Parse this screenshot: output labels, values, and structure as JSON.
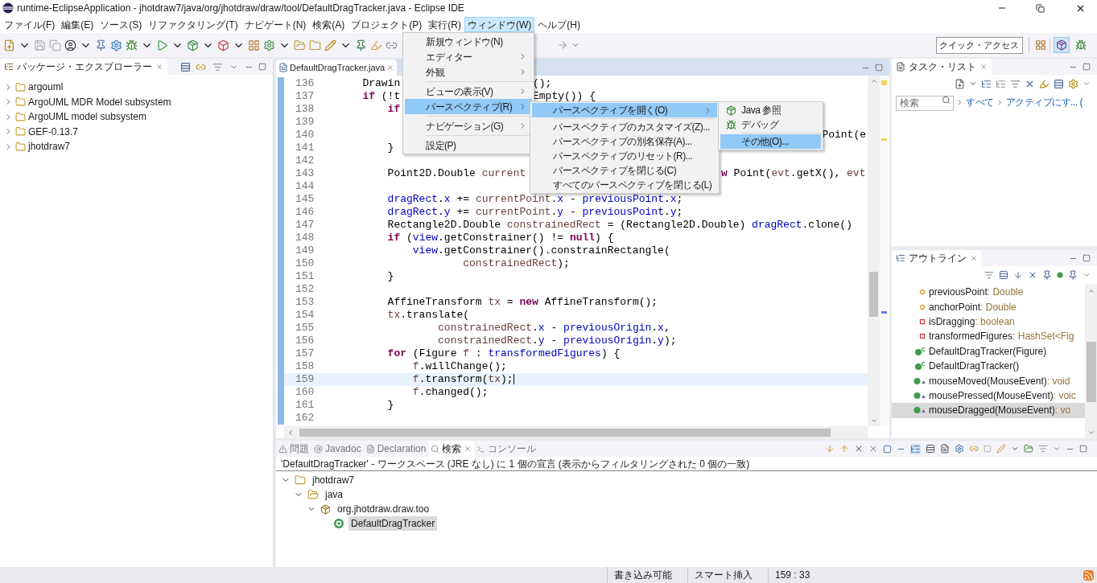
{
  "window": {
    "title": "runtime-EclipseApplication - jhotdraw7/java/org/jhotdraw/draw/tool/DefaultDragTracker.java - Eclipse IDE"
  },
  "menu_bar": [
    {
      "label": "ファイル(F)",
      "selected": false
    },
    {
      "label": "編集(E)",
      "selected": false
    },
    {
      "label": "ソース(S)",
      "selected": false
    },
    {
      "label": "リファクタリング(T)",
      "selected": false
    },
    {
      "label": "ナビゲート(N)",
      "selected": false
    },
    {
      "label": "検索(A)",
      "selected": false
    },
    {
      "label": "プロジェクト(P)",
      "selected": false
    },
    {
      "label": "実行(R)",
      "selected": false
    },
    {
      "label": "ウィンドウ(W)",
      "selected": true
    },
    {
      "label": "ヘルプ(H)",
      "selected": false
    }
  ],
  "toolbar": {
    "quick_access": {
      "placeholder": "クイック・アクセス"
    },
    "perspectives": [
      {
        "kind": "java",
        "selected": true
      },
      {
        "kind": "debug",
        "selected": false
      }
    ]
  },
  "package_explorer": {
    "tab": "パッケージ・エクスプローラー",
    "items": [
      {
        "label": "argouml",
        "expanded": false
      },
      {
        "label": "ArgoUML MDR Model subsystem",
        "expanded": false
      },
      {
        "label": "ArgoUML model subsystem",
        "expanded": false
      },
      {
        "label": "GEF-0.13.7",
        "expanded": false
      },
      {
        "label": "jhotdraw7",
        "expanded": false
      }
    ]
  },
  "editor": {
    "tab": "DefaultDragTracker.java",
    "lines": [
      {
        "number": "136",
        "current": false,
        "segments": [
          {
            "kind": "plain",
            "t": "        Drawin"
          }
        ],
        "right": {
          "kind": "after_window_menu",
          "segments": [
            {
              "kind": "plain",
              "t": "();"
            }
          ]
        }
      },
      {
        "number": "137",
        "current": false,
        "segments": [
          {
            "kind": "keyword",
            "t": "        if"
          },
          {
            "kind": "plain",
            "t": " (!t"
          }
        ],
        "right": {
          "kind": "after_window_menu",
          "segments": [
            {
              "kind": "plain",
              "t": "Empty()) {"
            }
          ]
        }
      },
      {
        "number": "138",
        "current": false,
        "segments": [
          {
            "kind": "keyword",
            "t": "            if"
          }
        ]
      },
      {
        "number": "139",
        "current": false
      },
      {
        "number": "140",
        "current": false,
        "right": {
          "kind": "after_other_submenu",
          "segments": [
            {
              "kind": "plain",
              "t": "Point(e"
            }
          ]
        }
      },
      {
        "number": "141",
        "current": false,
        "segments": [
          {
            "kind": "plain",
            "t": "            }"
          }
        ]
      },
      {
        "number": "142",
        "current": false
      },
      {
        "number": "143",
        "current": false,
        "segments": [
          {
            "kind": "plain",
            "t": "            Point2D.Double "
          },
          {
            "kind": "local",
            "t": "current"
          }
        ],
        "right": {
          "kind": "after_open_submenu",
          "segments": [
            {
              "kind": "keyword",
              "t": "w"
            },
            {
              "kind": "plain",
              "t": " Point("
            },
            {
              "kind": "local",
              "t": "evt"
            },
            {
              "kind": "plain",
              "t": ".getX(), "
            },
            {
              "kind": "local",
              "t": "evt"
            }
          ]
        }
      },
      {
        "number": "144",
        "current": false
      },
      {
        "number": "145",
        "current": false,
        "segments": [
          {
            "kind": "field",
            "t": "            dragRect"
          },
          {
            "kind": "plain",
            "t": "."
          },
          {
            "kind": "field",
            "t": "x"
          },
          {
            "kind": "plain",
            "t": " += "
          },
          {
            "kind": "local",
            "t": "currentPoint"
          },
          {
            "kind": "plain",
            "t": "."
          },
          {
            "kind": "field",
            "t": "x"
          },
          {
            "kind": "plain",
            "t": " - "
          },
          {
            "kind": "field",
            "t": "previousPoint"
          },
          {
            "kind": "plain",
            "t": "."
          },
          {
            "kind": "field",
            "t": "x"
          },
          {
            "kind": "plain",
            "t": ";"
          }
        ]
      },
      {
        "number": "146",
        "current": false,
        "segments": [
          {
            "kind": "field",
            "t": "            dragRect"
          },
          {
            "kind": "plain",
            "t": "."
          },
          {
            "kind": "field",
            "t": "y"
          },
          {
            "kind": "plain",
            "t": " += "
          },
          {
            "kind": "local",
            "t": "currentPoint"
          },
          {
            "kind": "plain",
            "t": "."
          },
          {
            "kind": "field",
            "t": "y"
          },
          {
            "kind": "plain",
            "t": " - "
          },
          {
            "kind": "field",
            "t": "previousPoint"
          },
          {
            "kind": "plain",
            "t": "."
          },
          {
            "kind": "field",
            "t": "y"
          },
          {
            "kind": "plain",
            "t": ";"
          }
        ]
      },
      {
        "number": "147",
        "current": false,
        "segments": [
          {
            "kind": "plain",
            "t": "            Rectangle2D.Double "
          },
          {
            "kind": "local",
            "t": "constrainedRect"
          },
          {
            "kind": "plain",
            "t": " = (Rectangle2D.Double) "
          },
          {
            "kind": "field",
            "t": "dragRect"
          },
          {
            "kind": "plain",
            "t": ".clone()"
          }
        ]
      },
      {
        "number": "148",
        "current": false,
        "segments": [
          {
            "kind": "keyword",
            "t": "            if"
          },
          {
            "kind": "plain",
            "t": " ("
          },
          {
            "kind": "field",
            "t": "view"
          },
          {
            "kind": "plain",
            "t": ".getConstrainer() != "
          },
          {
            "kind": "keyword",
            "t": "null"
          },
          {
            "kind": "plain",
            "t": ") {"
          }
        ]
      },
      {
        "number": "149",
        "current": false,
        "segments": [
          {
            "kind": "field",
            "t": "                view"
          },
          {
            "kind": "plain",
            "t": ".getConstrainer().constrainRectangle("
          }
        ]
      },
      {
        "number": "150",
        "current": false,
        "segments": [
          {
            "kind": "local",
            "t": "                        constrainedRect"
          },
          {
            "kind": "plain",
            "t": ");"
          }
        ]
      },
      {
        "number": "151",
        "current": false,
        "segments": [
          {
            "kind": "plain",
            "t": "            }"
          }
        ]
      },
      {
        "number": "152",
        "current": false
      },
      {
        "number": "153",
        "current": false,
        "segments": [
          {
            "kind": "plain",
            "t": "            AffineTransform "
          },
          {
            "kind": "local",
            "t": "tx"
          },
          {
            "kind": "plain",
            "t": " = "
          },
          {
            "kind": "keyword",
            "t": "new"
          },
          {
            "kind": "plain",
            "t": " AffineTransform();"
          }
        ]
      },
      {
        "number": "154",
        "current": false,
        "segments": [
          {
            "kind": "local",
            "t": "            tx"
          },
          {
            "kind": "plain",
            "t": ".translate("
          }
        ]
      },
      {
        "number": "155",
        "current": false,
        "segments": [
          {
            "kind": "local",
            "t": "                    constrainedRect"
          },
          {
            "kind": "plain",
            "t": "."
          },
          {
            "kind": "field",
            "t": "x"
          },
          {
            "kind": "plain",
            "t": " - "
          },
          {
            "kind": "field",
            "t": "previousOrigin"
          },
          {
            "kind": "plain",
            "t": "."
          },
          {
            "kind": "field",
            "t": "x"
          },
          {
            "kind": "plain",
            "t": ","
          }
        ]
      },
      {
        "number": "156",
        "current": false,
        "segments": [
          {
            "kind": "local",
            "t": "                    constrainedRect"
          },
          {
            "kind": "plain",
            "t": "."
          },
          {
            "kind": "field",
            "t": "y"
          },
          {
            "kind": "plain",
            "t": " - "
          },
          {
            "kind": "field",
            "t": "previousOrigin"
          },
          {
            "kind": "plain",
            "t": "."
          },
          {
            "kind": "field",
            "t": "y"
          },
          {
            "kind": "plain",
            "t": ");"
          }
        ]
      },
      {
        "number": "157",
        "current": false,
        "segments": [
          {
            "kind": "keyword",
            "t": "            for"
          },
          {
            "kind": "plain",
            "t": " (Figure "
          },
          {
            "kind": "local",
            "t": "f"
          },
          {
            "kind": "plain",
            "t": " : "
          },
          {
            "kind": "field",
            "t": "transformedFigures"
          },
          {
            "kind": "plain",
            "t": ") {"
          }
        ]
      },
      {
        "number": "158",
        "current": false,
        "segments": [
          {
            "kind": "local",
            "t": "                f"
          },
          {
            "kind": "plain",
            "t": ".willChange();"
          }
        ]
      },
      {
        "number": "159",
        "current": true,
        "segments": [
          {
            "kind": "local",
            "t": "                f"
          },
          {
            "kind": "plain",
            "t": ".transform("
          },
          {
            "kind": "local",
            "t": "tx"
          },
          {
            "kind": "plain",
            "t": ");"
          }
        ]
      },
      {
        "number": "160",
        "current": false,
        "segments": [
          {
            "kind": "local",
            "t": "                f"
          },
          {
            "kind": "plain",
            "t": ".changed();"
          }
        ]
      },
      {
        "number": "161",
        "current": false,
        "segments": [
          {
            "kind": "plain",
            "t": "            }"
          }
        ]
      },
      {
        "number": "162",
        "current": false
      }
    ]
  },
  "window_menu": [
    {
      "kind": "item",
      "label": "新規ウィンドウ(N)",
      "submenu": false,
      "selected": false
    },
    {
      "kind": "item",
      "label": "エディター",
      "submenu": true,
      "selected": false
    },
    {
      "kind": "item",
      "label": "外観",
      "submenu": true,
      "selected": false
    },
    {
      "kind": "separator"
    },
    {
      "kind": "item",
      "label": "ビューの表示(V)",
      "submenu": true,
      "selected": false
    },
    {
      "kind": "item",
      "label": "パースペクティブ(R)",
      "submenu": true,
      "selected": true
    },
    {
      "kind": "separator"
    },
    {
      "kind": "item",
      "label": "ナビゲーション(G)",
      "submenu": true,
      "selected": false
    },
    {
      "kind": "separator"
    },
    {
      "kind": "item",
      "label": "設定(P)",
      "submenu": false,
      "selected": false
    }
  ],
  "perspective_menu": [
    {
      "kind": "item",
      "label": "パースペクティブを開く(O)",
      "submenu": true,
      "selected": true
    },
    {
      "kind": "separator"
    },
    {
      "kind": "item",
      "label": "パースペクティブのカスタマイズ(Z)...",
      "submenu": false,
      "selected": false
    },
    {
      "kind": "item",
      "label": "パースペクティブの別名保存(A)...",
      "submenu": false,
      "selected": false
    },
    {
      "kind": "item",
      "label": "パースペクティブのリセット(R)...",
      "submenu": false,
      "selected": false
    },
    {
      "kind": "item",
      "label": "パースペクティブを閉じる(C)",
      "submenu": false,
      "selected": false
    },
    {
      "kind": "item",
      "label": "すべてのパースペクティブを閉じる(L)",
      "submenu": false,
      "selected": false
    }
  ],
  "open_perspective_menu": [
    {
      "kind": "java_item",
      "label": "Java 参照",
      "submenu": false,
      "selected": false
    },
    {
      "kind": "debug_item",
      "label": "デバッグ",
      "submenu": false,
      "selected": false
    },
    {
      "kind": "separator"
    },
    {
      "kind": "item",
      "label": "その他(O)...",
      "submenu": false,
      "selected": true
    }
  ],
  "task_list": {
    "tab": "タスク・リスト",
    "search": {
      "placeholder": "検索"
    },
    "filters": [
      "すべて",
      "アクティブにす...",
      "("
    ]
  },
  "outline": {
    "tab": "アウトライン",
    "items": [
      {
        "kind": "protected_field",
        "name": "previousPoint",
        "type": " : Double",
        "selected": false
      },
      {
        "kind": "protected_field",
        "name": "anchorPoint",
        "type": " : Double",
        "selected": false
      },
      {
        "kind": "private_field",
        "name": "isDragging",
        "type": " : boolean",
        "selected": false
      },
      {
        "kind": "private_field",
        "name": "transformedFigures",
        "type": " : HashSet<Fig",
        "selected": false
      },
      {
        "kind": "constructor",
        "name": "DefaultDragTracker(Figure)",
        "selected": false
      },
      {
        "kind": "constructor",
        "name": "DefaultDragTracker()",
        "selected": false
      },
      {
        "kind": "method",
        "name": "mouseMoved(MouseEvent)",
        "type": " : void",
        "selected": false
      },
      {
        "kind": "method",
        "name": "mousePressed(MouseEvent)",
        "type": " : voic",
        "selected": false
      },
      {
        "kind": "method",
        "name": "mouseDragged(MouseEvent)",
        "type": " : vo",
        "selected": true
      }
    ]
  },
  "bottom_panel": {
    "tabs": [
      {
        "kind": "problems",
        "label": "問題",
        "selected": false
      },
      {
        "kind": "javadoc",
        "label": "Javadoc",
        "selected": false
      },
      {
        "kind": "declaration",
        "label": "Declaration",
        "selected": false
      },
      {
        "kind": "search",
        "label": "検索",
        "selected": true
      },
      {
        "kind": "console",
        "label": "コンソール",
        "selected": false
      }
    ],
    "summary": "'DefaultDragTracker' - ワークスペース (JRE なし) に 1 個の宣言 (表示からフィルタリングされた 0 個の一致)",
    "results": [
      {
        "kind": "project",
        "label": "jhotdraw7",
        "expanded": true,
        "selected": false,
        "children": [
          {
            "kind": "source_folder",
            "label": "java",
            "expanded": true,
            "selected": false,
            "children": [
              {
                "kind": "package",
                "label": "org.jhotdraw.draw.too",
                "expanded": true,
                "selected": false,
                "children": [
                  {
                    "kind": "class",
                    "label": "DefaultDragTracker",
                    "selected": true
                  }
                ]
              }
            ]
          }
        ]
      }
    ]
  },
  "status_bar": [
    "書き込み可能",
    "スマート挿入",
    "159 : 33"
  ]
}
